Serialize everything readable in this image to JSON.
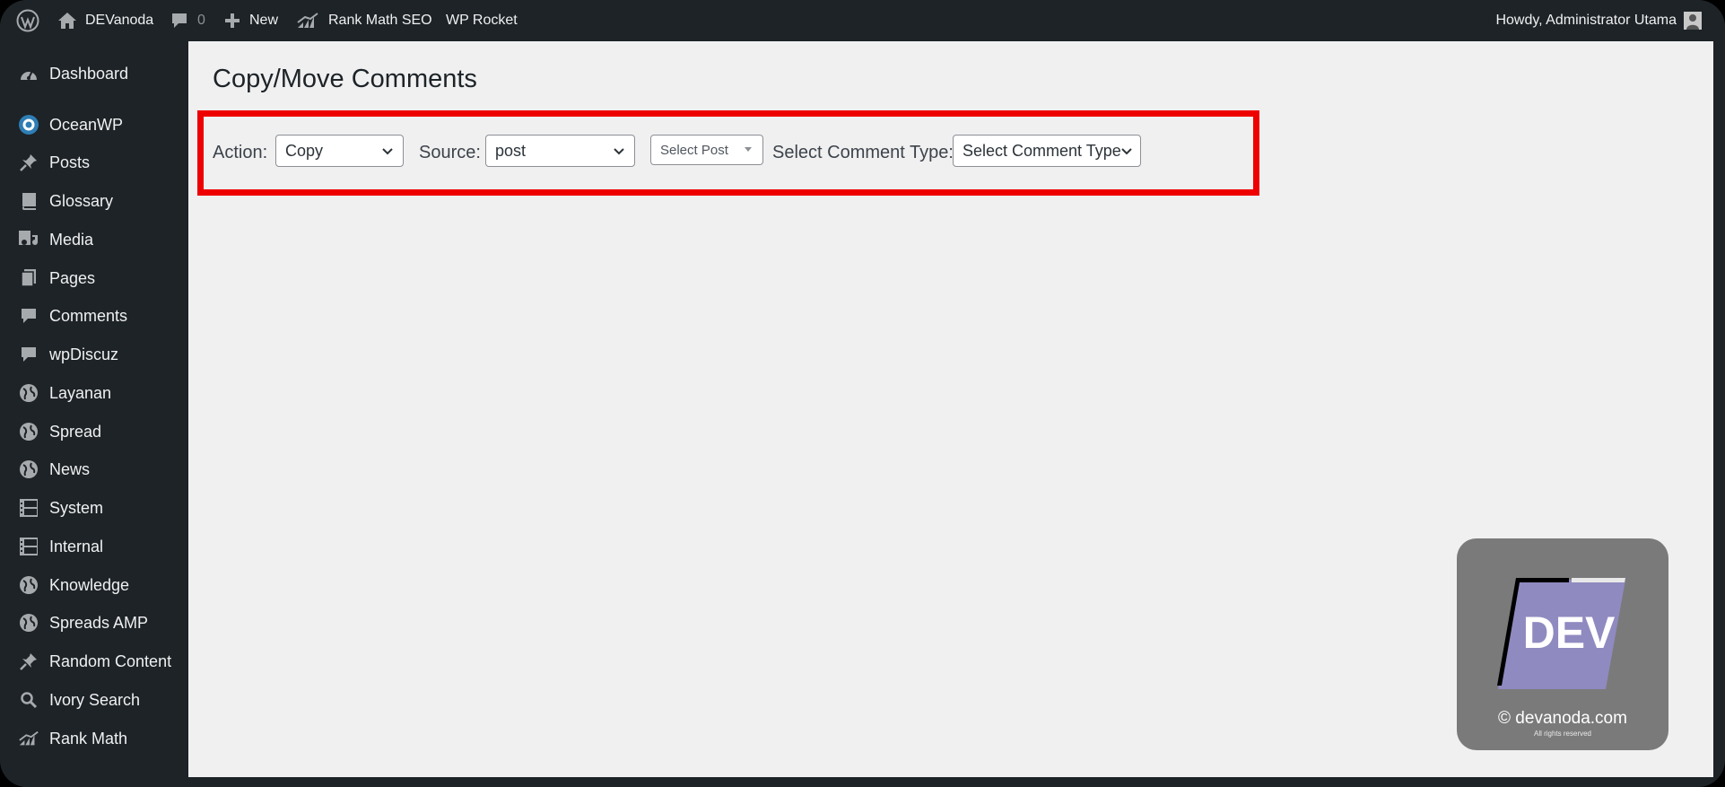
{
  "adminbar": {
    "site_name": "DEVanoda",
    "comments_count": "0",
    "new_label": "New",
    "rank_math_label": "Rank Math SEO",
    "wp_rocket_label": "WP Rocket",
    "howdy": "Howdy, Administrator Utama"
  },
  "sidebar": {
    "items": [
      {
        "label": "Dashboard",
        "icon": "dashboard-icon"
      },
      {
        "label": "OceanWP",
        "icon": "oceanwp-icon"
      },
      {
        "label": "Posts",
        "icon": "pushpin-icon"
      },
      {
        "label": "Glossary",
        "icon": "book-icon"
      },
      {
        "label": "Media",
        "icon": "media-icon"
      },
      {
        "label": "Pages",
        "icon": "pages-icon"
      },
      {
        "label": "Comments",
        "icon": "comment-icon"
      },
      {
        "label": "wpDiscuz",
        "icon": "comment-icon"
      },
      {
        "label": "Layanan",
        "icon": "globe-icon"
      },
      {
        "label": "Spread",
        "icon": "globe-icon"
      },
      {
        "label": "News",
        "icon": "globe-icon"
      },
      {
        "label": "System",
        "icon": "film-icon"
      },
      {
        "label": "Internal",
        "icon": "film-icon"
      },
      {
        "label": "Knowledge",
        "icon": "globe-icon"
      },
      {
        "label": "Spreads AMP",
        "icon": "globe-icon"
      },
      {
        "label": "Random Content",
        "icon": "pushpin-icon"
      },
      {
        "label": "Ivory Search",
        "icon": "search-icon"
      },
      {
        "label": "Rank Math",
        "icon": "chart-icon"
      }
    ]
  },
  "page": {
    "title": "Copy/Move Comments"
  },
  "form": {
    "action_label": "Action:",
    "action_value": "Copy",
    "source_label": "Source:",
    "source_value": "post",
    "post_value": "Select Post",
    "comment_type_label": "Select Comment Type:",
    "comment_type_value": "Select Comment Type"
  },
  "watermark": {
    "logo_text": "DEV",
    "domain": "© devanoda.com",
    "rights": "All rights reserved"
  },
  "colors": {
    "admin_bg": "#1d2327",
    "content_bg": "#f0f0f1",
    "highlight": "#ee0000",
    "logo_purple": "#8f8ac0"
  }
}
